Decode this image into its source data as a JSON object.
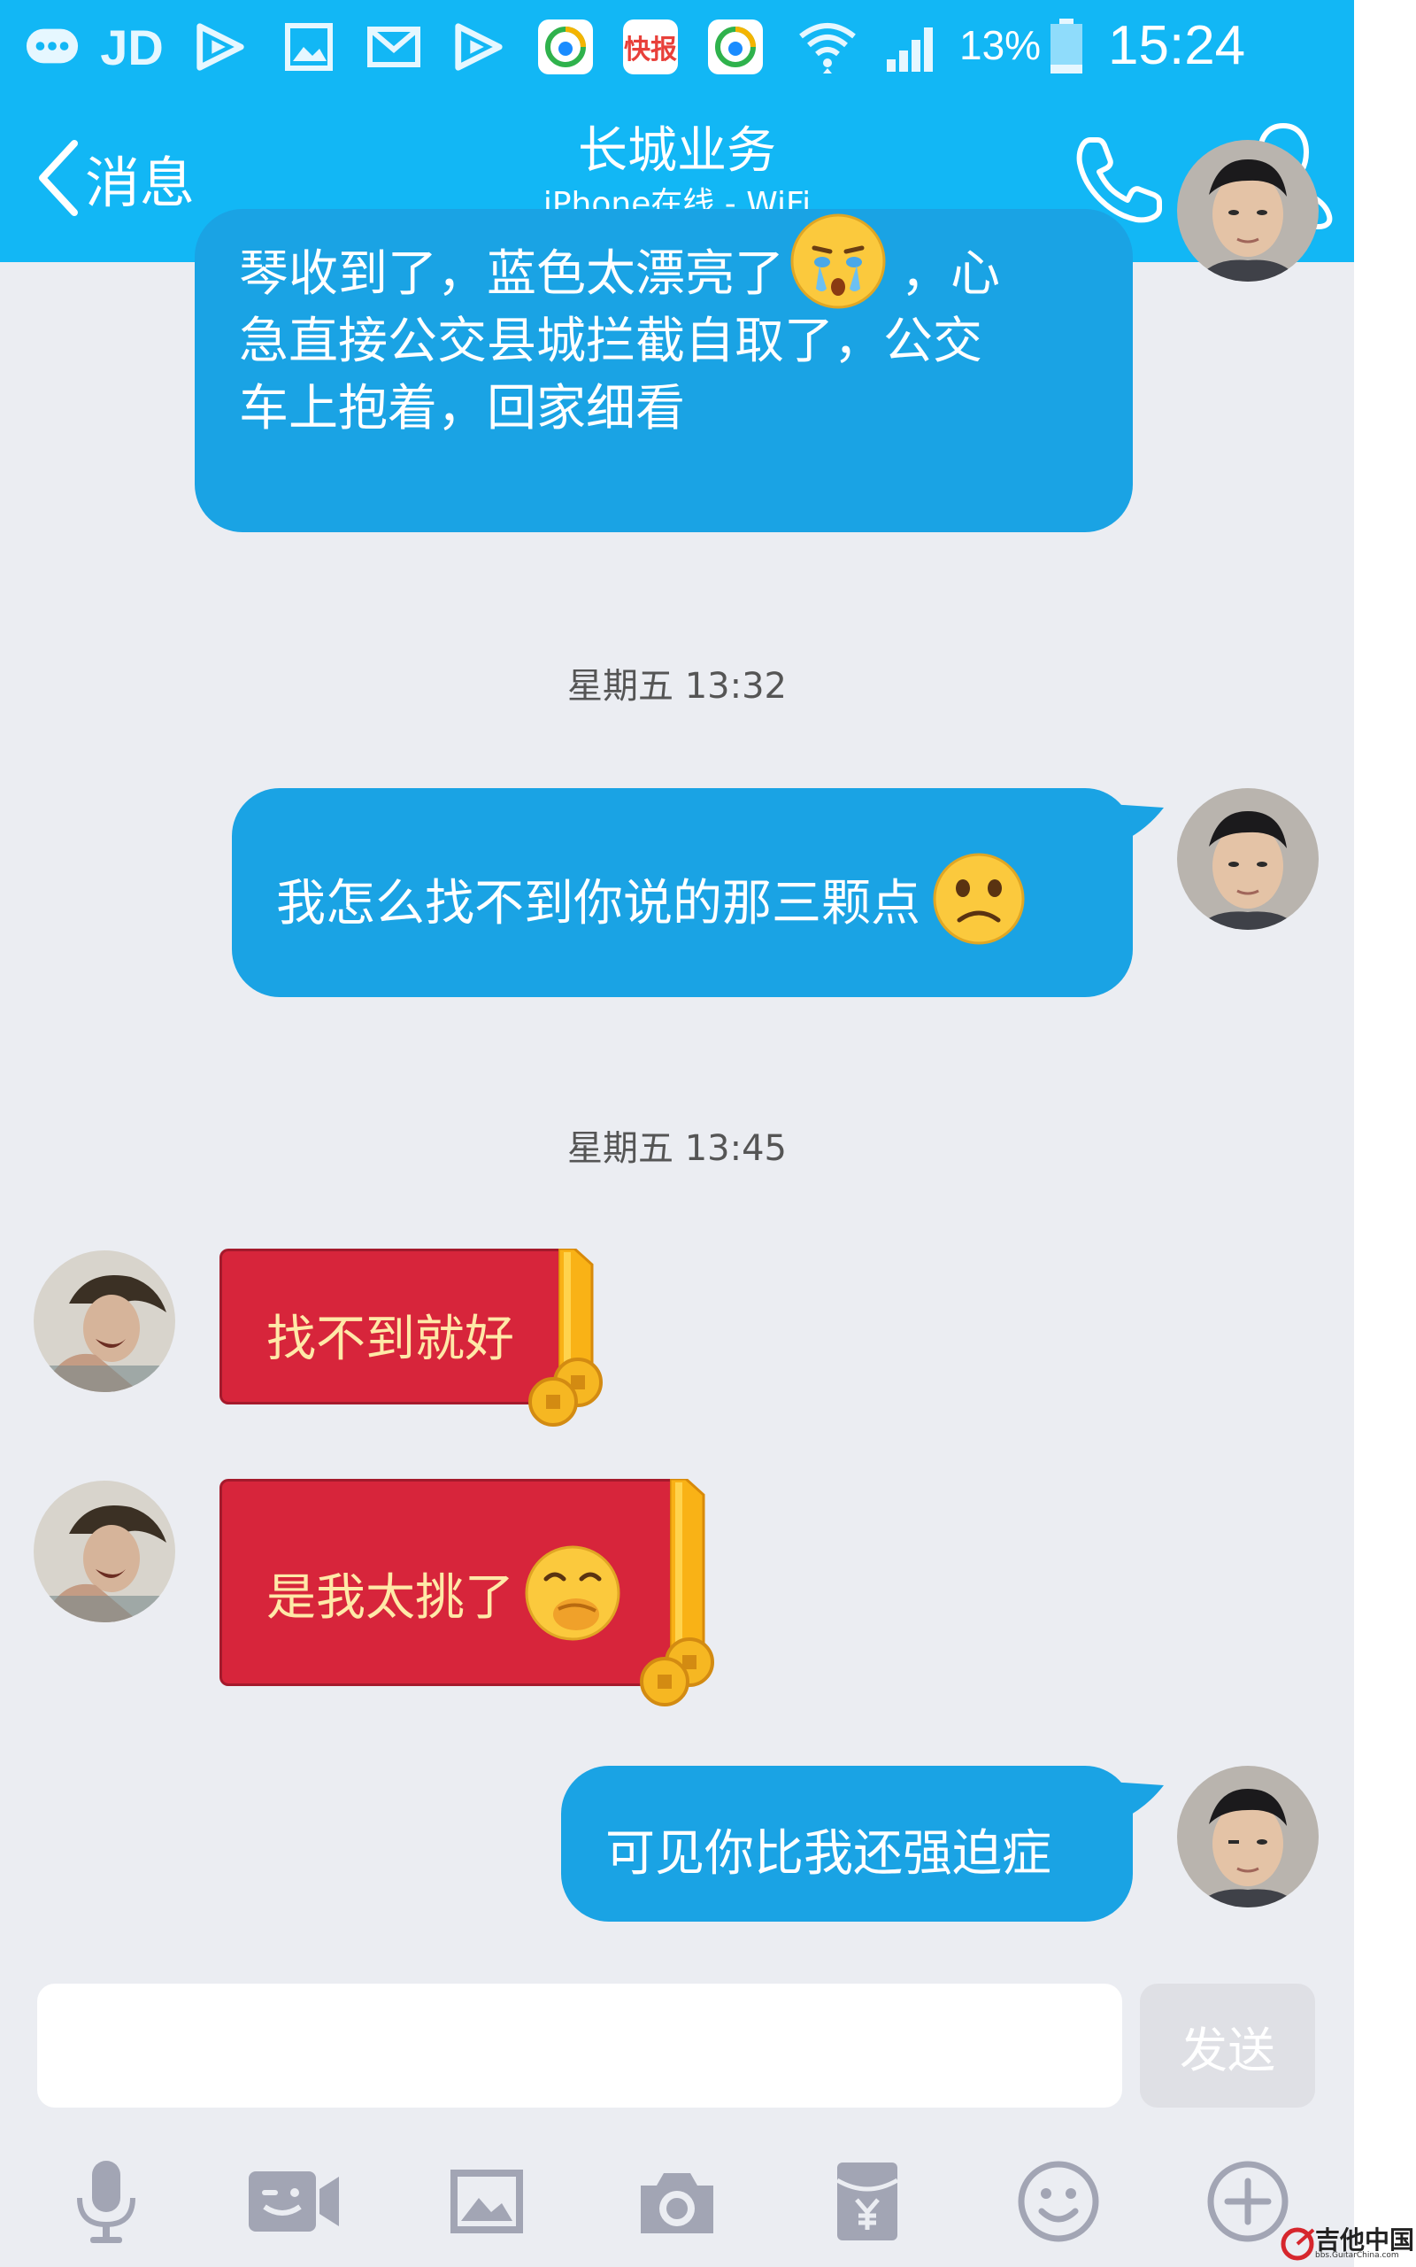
{
  "status_bar": {
    "app_icons": [
      "message-icon",
      "jd-icon",
      "video-icon",
      "gallery-icon",
      "mail-icon",
      "video-icon",
      "qq-browser-icon",
      "kuaibao-icon",
      "qq-browser-icon"
    ],
    "jd_label": "JD",
    "kuaibao_label": "快报",
    "battery": "13%",
    "time": "15:24"
  },
  "nav": {
    "back_label": "消息",
    "title": "长城业务",
    "subtitle": "iPhone在线 - WiFi"
  },
  "messages": [
    {
      "type": "text",
      "side": "right",
      "lines": [
        "琴收到了，蓝色太漂亮了",
        "，心",
        "急直接公交县城拦截自取了，公交",
        "车上抱着，回家细看"
      ],
      "emoji": "crying-emoji"
    },
    {
      "type": "timestamp",
      "text": "星期五 13:32"
    },
    {
      "type": "text",
      "side": "right",
      "text": "我怎么找不到你说的那三颗点",
      "emoji": "frown-emoji"
    },
    {
      "type": "timestamp",
      "text": "星期五 13:45"
    },
    {
      "type": "redpacket",
      "side": "left",
      "text": "找不到就好"
    },
    {
      "type": "redpacket",
      "side": "left",
      "text": "是我太挑了",
      "emoji": "giggle-emoji"
    },
    {
      "type": "text",
      "side": "right",
      "text": "可见你比我还强迫症"
    }
  ],
  "input": {
    "value": "",
    "send_label": "发送"
  },
  "toolbar": [
    "microphone-icon",
    "video-call-icon",
    "image-icon",
    "camera-icon",
    "red-packet-icon",
    "emoji-icon",
    "plus-icon"
  ],
  "watermark": {
    "line1": "吉他中国",
    "line2": "bbs.GuitarChina.com"
  },
  "colors": {
    "header": "#12b7f5",
    "bubble_out": "#1aa3e4",
    "redpacket": "#d7253b",
    "background": "#ebedf2"
  }
}
